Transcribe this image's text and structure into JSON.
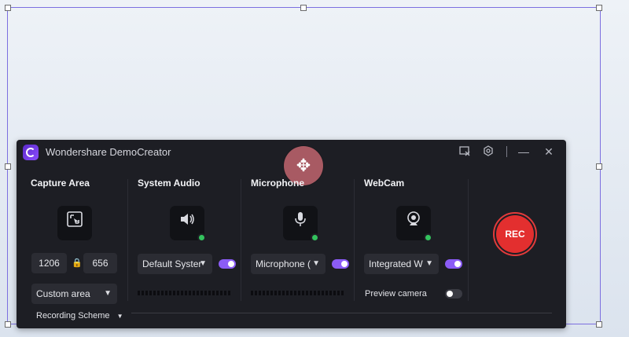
{
  "window": {
    "title": "Wondershare DemoCreator"
  },
  "toolbar": {
    "icons": [
      "screenshot-icon",
      "settings-icon",
      "minimize-icon",
      "close-icon"
    ],
    "minimize_label": "—",
    "close_label": "✕"
  },
  "move_handle": {
    "icon": "move-arrows-icon"
  },
  "capture_area": {
    "title": "Capture Area",
    "width": "1206",
    "height": "656",
    "mode": "Custom area",
    "scheme_label": "Recording Scheme"
  },
  "system_audio": {
    "title": "System Audio",
    "device": "Default Syster",
    "enabled": true
  },
  "microphone": {
    "title": "Microphone",
    "device": "Microphone (",
    "enabled": true
  },
  "webcam": {
    "title": "WebCam",
    "device": "Integrated W",
    "enabled": true,
    "preview_label": "Preview camera",
    "preview_enabled": false
  },
  "record": {
    "label": "REC"
  },
  "colors": {
    "accent": "#8b5cf6",
    "record": "#e32f2f",
    "ok": "#33c25d",
    "selection": "#7c6fe0"
  }
}
